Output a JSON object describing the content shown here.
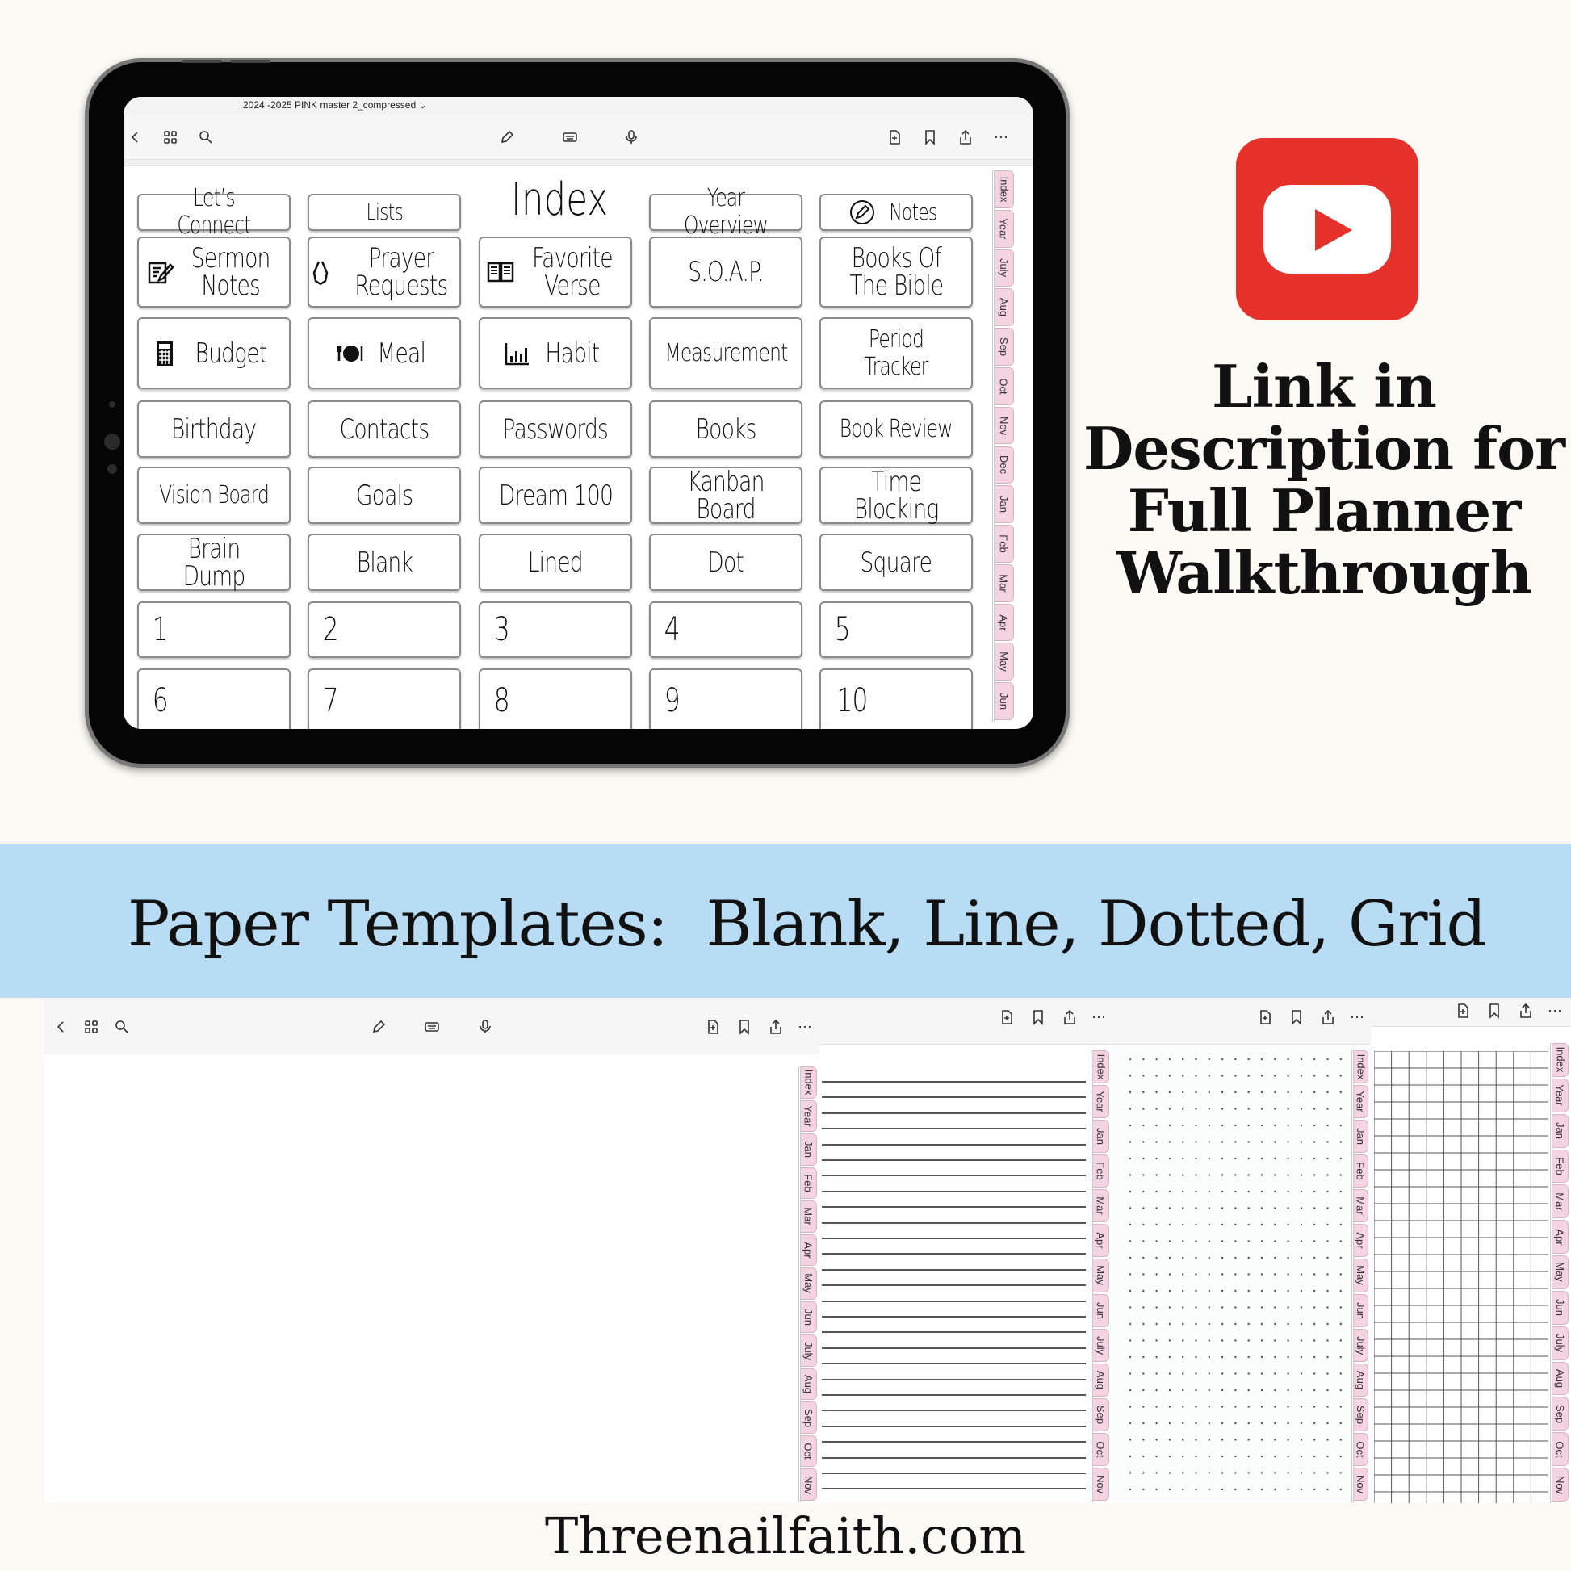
{
  "ipad": {
    "file_title": "2024 -2025 PINK master 2_compressed ⌄",
    "index_title": "Index",
    "cells": [
      [
        "Let’s Connect",
        "Lists",
        null,
        "Year Overview",
        "Notes"
      ],
      [
        "Sermon\nNotes",
        "Prayer\nRequests",
        "Favorite\nVerse",
        "S.O.A.P.",
        "Books Of\nThe Bible"
      ],
      [
        "Budget",
        "Meal",
        "Habit",
        "Measurement",
        "Period Tracker"
      ],
      [
        "Birthday",
        "Contacts",
        "Passwords",
        "Books",
        "Book Review"
      ],
      [
        "Vision Board",
        "Goals",
        "Dream 100",
        "Kanban\nBoard",
        "Time\nBlocking"
      ],
      [
        "Brain Dump",
        "Blank",
        "Lined",
        "Dot",
        "Square"
      ],
      [
        "1",
        "2",
        "3",
        "4",
        "5"
      ],
      [
        "6",
        "7",
        "8",
        "9",
        "10"
      ]
    ],
    "cell_icons": {
      "0-4": "pencil-circle-icon",
      "1-0": "notepad-pen-icon",
      "1-1": "praying-hands-icon",
      "1-2": "open-book-icon",
      "2-0": "calculator-icon",
      "2-1": "plate-cutlery-icon",
      "2-2": "bar-chart-icon"
    },
    "tabs": [
      "Index",
      "Year",
      "July",
      "Aug",
      "Sep",
      "Oct",
      "Nov",
      "Dec",
      "Jan",
      "Feb",
      "Mar",
      "Apr",
      "May",
      "Jun"
    ]
  },
  "promo": {
    "youtube_color": "#e5312a",
    "link_text": [
      "Link in",
      "Description for",
      "Full Planner",
      "Walkthrough"
    ]
  },
  "banner": {
    "text": "Paper Templates:  Blank, Line, Dotted, Grid",
    "color": "#b8dcf3"
  },
  "templates": {
    "blank_tabs": [
      "Index",
      "Year",
      "Jan",
      "Feb",
      "Mar",
      "Apr",
      "May",
      "Jun",
      "July",
      "Aug",
      "Sep",
      "Oct",
      "Nov"
    ],
    "lined_tabs": [
      "Index",
      "Year",
      "Jan",
      "Feb",
      "Mar",
      "Apr",
      "May",
      "Jun",
      "July",
      "Aug",
      "Sep",
      "Oct",
      "Nov"
    ],
    "dotted_tabs": [
      "Index",
      "Year",
      "Jan",
      "Feb",
      "Mar",
      "Apr",
      "May",
      "Jun",
      "July",
      "Aug",
      "Sep",
      "Oct",
      "Nov"
    ],
    "grid_tabs": [
      "Index",
      "Year",
      "Jan",
      "Feb",
      "Mar",
      "Apr",
      "May",
      "Jun",
      "July",
      "Aug",
      "Sep",
      "Oct",
      "Nov"
    ]
  },
  "footer": {
    "website": "Threenailfaith.com"
  },
  "tab_color": "#f4d3e2"
}
